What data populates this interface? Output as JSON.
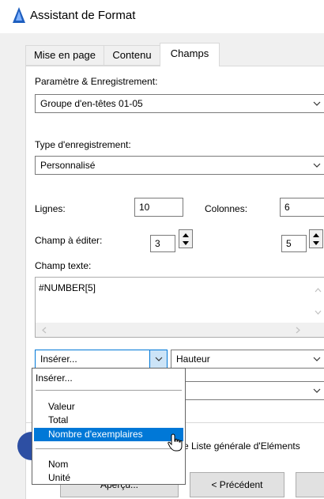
{
  "window": {
    "title": "Assistant de Format"
  },
  "tabs": [
    {
      "label": "Mise en page"
    },
    {
      "label": "Contenu"
    },
    {
      "label": "Champs"
    }
  ],
  "settings": {
    "label": "Paramètre & Enregistrement:",
    "value": "Groupe d'en-têtes 01-05"
  },
  "record_type": {
    "label": "Type d'enregistrement:",
    "value": "Personnalisé"
  },
  "grid": {
    "rows_label": "Lignes:",
    "rows_value": "10",
    "cols_label": "Colonnes:",
    "cols_value": "6"
  },
  "edit_field": {
    "label": "Champ à éditer:",
    "value_a": "3",
    "value_b": "5"
  },
  "text_field": {
    "label": "Champ texte:",
    "value": "#NUMBER[5]"
  },
  "insert": {
    "value": "Insérer...",
    "property_value": "Hauteur",
    "options": [
      "Insérer...",
      "Valeur",
      "Total",
      "Nombre d'exemplaires",
      "Nom",
      "Unité"
    ],
    "selected": "Nombre d'exemplaires"
  },
  "bottom": {
    "element_list_label": "e Liste générale d'Eléments",
    "preview_label": "Aperçu...",
    "previous_label": "< Précédent"
  },
  "colors": {
    "selection": "#0078d7",
    "round_button": "#2d4fa3"
  }
}
